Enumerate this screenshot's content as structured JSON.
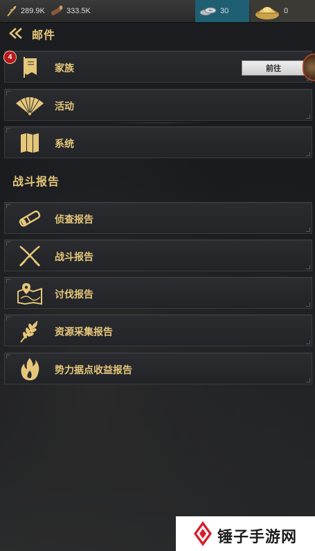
{
  "resources": {
    "grain": "289.9K",
    "wood": "333.5K",
    "silver": "30",
    "gold": "0"
  },
  "header": {
    "title": "邮件"
  },
  "mail_categories": [
    {
      "label": "家族",
      "icon": "banner-icon",
      "badge": "4",
      "action": "前往"
    },
    {
      "label": "活动",
      "icon": "fan-icon"
    },
    {
      "label": "系统",
      "icon": "map-icon"
    }
  ],
  "battle_section": {
    "title": "战斗报告",
    "items": [
      {
        "label": "侦查报告",
        "icon": "spyglass-icon"
      },
      {
        "label": "战斗报告",
        "icon": "crossed-swords-icon"
      },
      {
        "label": "讨伐报告",
        "icon": "map-pin-icon"
      },
      {
        "label": "资源采集报告",
        "icon": "wheat-icon"
      },
      {
        "label": "势力据点收益报告",
        "icon": "flame-icon"
      }
    ]
  },
  "watermark": {
    "text": "锤子手游网"
  },
  "colors": {
    "accent_gold": "#e6c77a",
    "badge_red": "#b8171b",
    "silver_bg": "#1f5f74",
    "background": "#17191d"
  }
}
